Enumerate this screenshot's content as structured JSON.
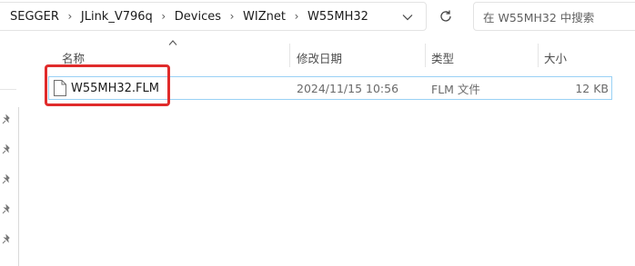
{
  "address_bar": {
    "breadcrumbs": [
      "SEGGER",
      "JLink_V796q",
      "Devices",
      "WIZnet",
      "W55MH32"
    ],
    "separator_icon": "chevron-right-icon",
    "dropdown_icon": "chevron-down-icon"
  },
  "toolbar": {
    "refresh_icon": "refresh-icon"
  },
  "search": {
    "placeholder": "在 W55MH32 中搜索"
  },
  "columns": {
    "name": "名称",
    "modified": "修改日期",
    "type": "类型",
    "size": "大小",
    "sort_icon": "sort-up-icon"
  },
  "files": [
    {
      "name": "W55MH32.FLM",
      "modified": "2024/11/15 10:56",
      "type": "FLM 文件",
      "size": "12 KB",
      "icon": "file-icon"
    }
  ],
  "annotation": {
    "color": "#e02b2b"
  },
  "colors": {
    "selection_border": "#99d1f5",
    "text_primary": "#1b1b1b",
    "text_secondary": "#6a6a6a"
  }
}
